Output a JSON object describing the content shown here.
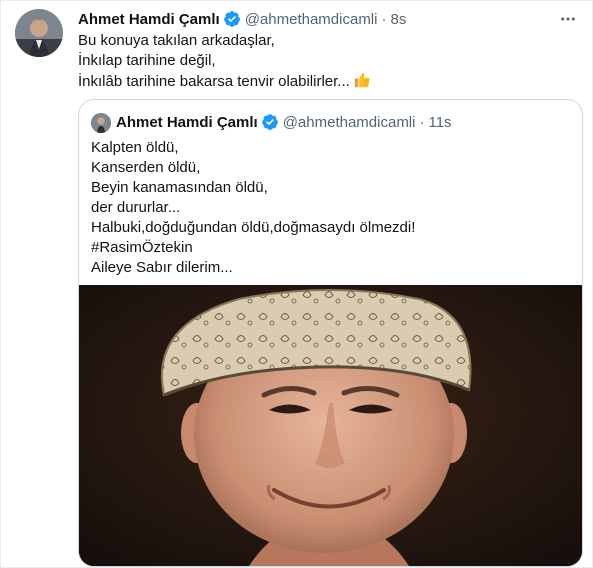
{
  "tweet": {
    "author_name": "Ahmet Hamdi Çamlı",
    "handle": "@ahmethamdicamli",
    "separator": "·",
    "time": "8s",
    "lines": [
      "Bu konuya takılan arkadaşlar,",
      "İnkılap tarihine değil,",
      "İnkılâb tarihine bakarsa tenvir olabilirler..."
    ],
    "emoji": "thumbs-up",
    "more_icon": "more-horizontal-icon"
  },
  "quote": {
    "author_name": "Ahmet Hamdi Çamlı",
    "handle": "@ahmethamdicamli",
    "separator": "·",
    "time": "11s",
    "lines": [
      "Kalpten öldü,",
      "Kanserden öldü,",
      "Beyin kanamasından öldü,",
      "der dururlar...",
      "Halbuki,doğduğundan öldü,doğmasaydı ölmezdi!",
      "#RasimÖztekin",
      "Aileye Sabır dilerim..."
    ]
  },
  "colors": {
    "text": "#0f1419",
    "secondary": "#536471",
    "verified": "#1d9bf0",
    "border": "#cfd9de"
  }
}
